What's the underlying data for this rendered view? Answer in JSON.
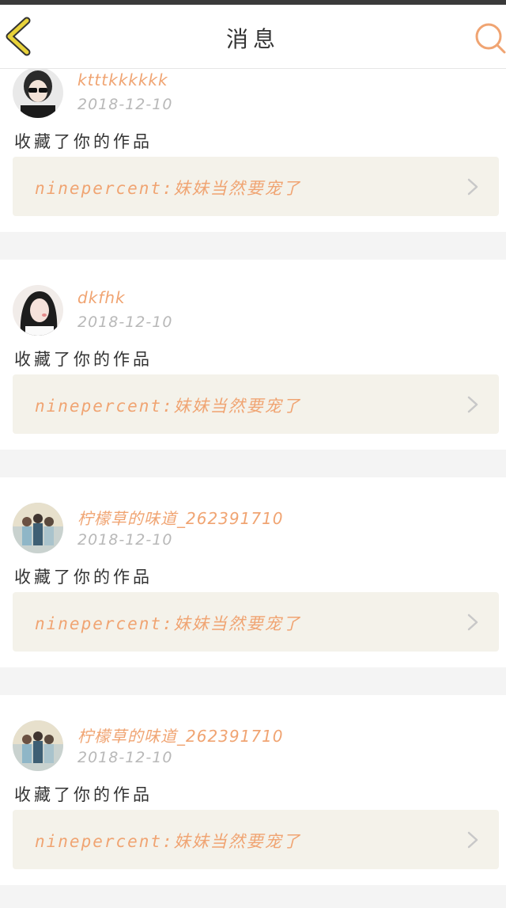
{
  "header": {
    "title": "消息",
    "back_icon": "chevron-left-icon",
    "search_icon": "search-icon",
    "accent_color": "#f0a472",
    "back_color": "#e8d23a"
  },
  "messages": [
    {
      "user": "ktttkkkkkk",
      "date": "2018-12-10",
      "action": "收藏了你的作品",
      "work": "ninepercent:妹妹当然要宠了"
    },
    {
      "user": "dkfhk",
      "date": "2018-12-10",
      "action": "收藏了你的作品",
      "work": "ninepercent:妹妹当然要宠了"
    },
    {
      "user": "柠檬草的味道_262391710",
      "date": "2018-12-10",
      "action": "收藏了你的作品",
      "work": "ninepercent:妹妹当然要宠了"
    },
    {
      "user": "柠檬草的味道_262391710",
      "date": "2018-12-10",
      "action": "收藏了你的作品",
      "work": "ninepercent:妹妹当然要宠了"
    }
  ]
}
